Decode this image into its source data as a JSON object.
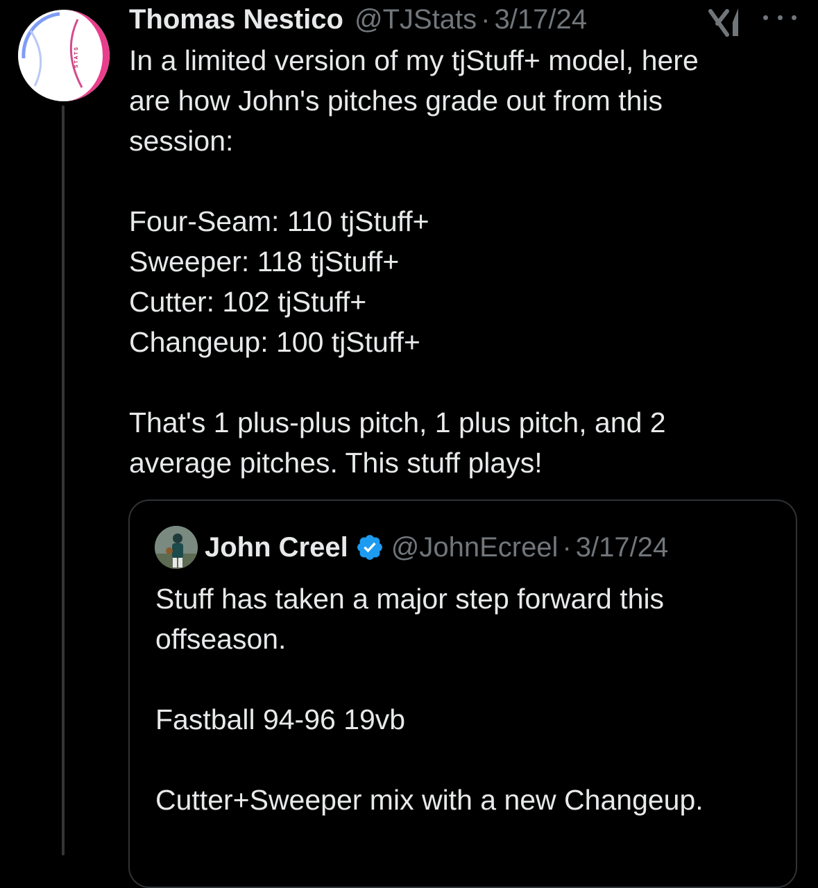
{
  "author": {
    "name": "Thomas Nestico",
    "handle": "@TJStats",
    "date": "3/17/24",
    "avatar_icon": "baseball-stats-logo-icon",
    "avatar_text": "STATS"
  },
  "tweet": {
    "text": "In a limited version of my tjStuff+ model, here\nare how John's pitches grade out from this\nsession:\n\nFour-Seam: 110 tjStuff+\nSweeper: 118 tjStuff+\nCutter: 102 tjStuff+\nChangeup: 100 tjStuff+\n\nThat's 1 plus-plus pitch, 1 plus pitch, and 2\naverage pitches. This stuff plays!"
  },
  "icons": {
    "grok": "grok-icon",
    "more": "more-icon",
    "verified": "verified-icon"
  },
  "quoted": {
    "name": "John Creel",
    "handle": "@JohnEcreel",
    "date": "3/17/24",
    "verified": true,
    "text": "Stuff has taken a major step forward this\noffseason.\n\nFastball 94-96 19vb\n\nCutter+Sweeper mix with a new Changeup."
  },
  "colors": {
    "background": "#000000",
    "text": "#e7e9ea",
    "secondary": "#71767b",
    "verified": "#1d9bf0",
    "border": "#2f3336"
  }
}
